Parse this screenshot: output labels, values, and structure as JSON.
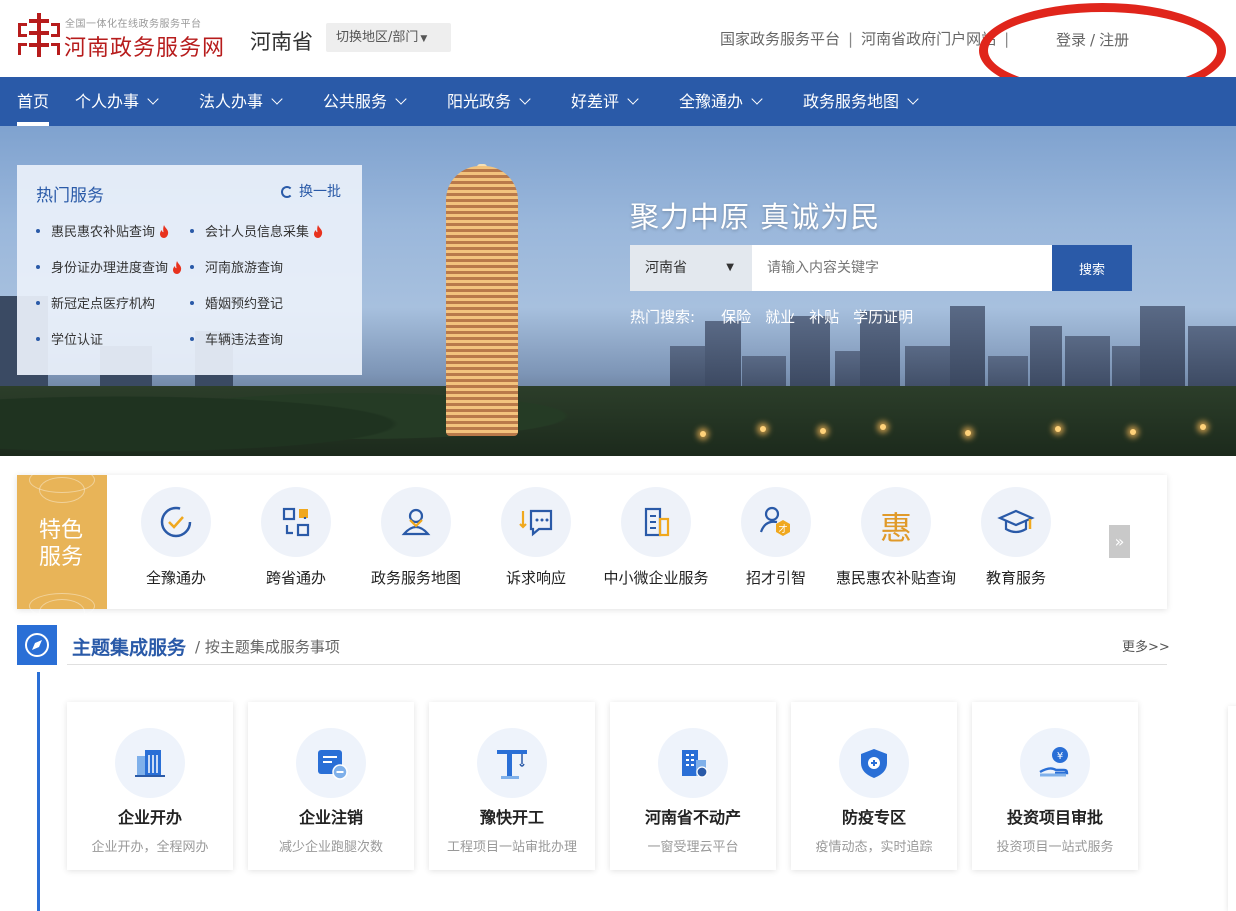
{
  "header": {
    "logo_subtitle": "全国一体化在线政务服务平台",
    "logo_title": "河南政务服务网",
    "province": "河南省",
    "switch_label": "切换地区/部门",
    "top_links": [
      "国家政务服务平台",
      "河南省政府门户网站"
    ],
    "login_label": "登录",
    "register_label": "注册"
  },
  "nav": {
    "items": [
      "首页",
      "个人办事",
      "法人办事",
      "公共服务",
      "阳光政务",
      "好差评",
      "全豫通办",
      "政务服务地图"
    ],
    "active": "首页"
  },
  "hero": {
    "slogan": "聚力中原   真诚为民",
    "search": {
      "region": "河南省",
      "placeholder": "请输入内容关键字",
      "button": "搜索",
      "hot_label": "热门搜索:",
      "hot_terms": [
        "保险",
        "就业",
        "补贴",
        "学历证明"
      ]
    }
  },
  "hot_services": {
    "title": "热门服务",
    "refresh_label": "换一批",
    "items": [
      {
        "label": "惠民惠农补贴查询",
        "hot": true
      },
      {
        "label": "会计人员信息采集",
        "hot": true
      },
      {
        "label": "身份证办理进度查询",
        "hot": true
      },
      {
        "label": "河南旅游查询",
        "hot": false
      },
      {
        "label": "新冠定点医疗机构",
        "hot": false
      },
      {
        "label": "婚姻预约登记",
        "hot": false
      },
      {
        "label": "学位认证",
        "hot": false
      },
      {
        "label": "车辆违法查询",
        "hot": false
      }
    ]
  },
  "featured": {
    "badge": "特色服务",
    "more_arrow": "»",
    "items": [
      {
        "label": "全豫通办",
        "icon": "clock-check-icon"
      },
      {
        "label": "跨省通办",
        "icon": "exchange-icon"
      },
      {
        "label": "政务服务地图",
        "icon": "map-user-icon"
      },
      {
        "label": "诉求响应",
        "icon": "chat-icon"
      },
      {
        "label": "中小微企业服务",
        "icon": "building-doc-icon"
      },
      {
        "label": "招才引智",
        "icon": "talent-icon"
      },
      {
        "label": "惠民惠农补贴查询",
        "icon": "hui-char-icon"
      },
      {
        "label": "教育服务",
        "icon": "graduation-cap-icon"
      }
    ],
    "hui_char": "惠"
  },
  "theme": {
    "title": "主题集成服务",
    "subtitle": "/ 按主题集成服务事项",
    "more": "更多>>",
    "cards": [
      {
        "title": "企业开办",
        "desc": "企业开办，全程网办",
        "icon": "office-building-icon"
      },
      {
        "title": "企业注销",
        "desc": "减少企业跑腿次数",
        "icon": "cancel-doc-icon"
      },
      {
        "title": "豫快开工",
        "desc": "工程项目一站审批办理",
        "icon": "crane-icon"
      },
      {
        "title": "河南省不动产",
        "desc": "一窗受理云平台",
        "icon": "property-icon"
      },
      {
        "title": "防疫专区",
        "desc": "疫情动态，实时追踪",
        "icon": "shield-plus-icon"
      },
      {
        "title": "投资项目审批",
        "desc": "投资项目一站式服务",
        "icon": "investment-hand-icon"
      }
    ]
  },
  "colors": {
    "brand_blue": "#2a5aa8",
    "logo_red": "#b71c1c",
    "badge_gold": "#e8b458",
    "annotation_red": "#e0251b"
  }
}
